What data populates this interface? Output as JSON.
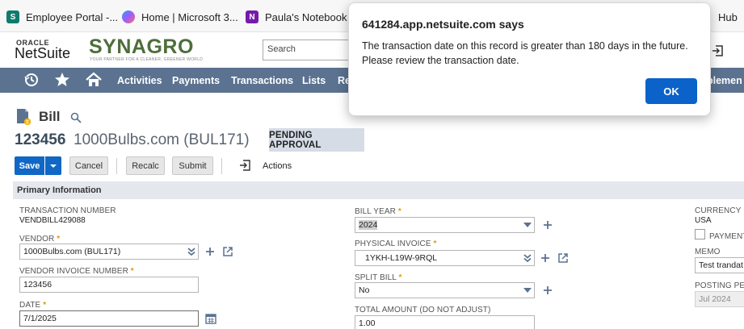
{
  "bookmarks": [
    {
      "label": "Employee Portal -...",
      "icon": "sharepoint-icon",
      "color": "#0f7b6c",
      "glyph": "S"
    },
    {
      "label": "Home | Microsoft 3...",
      "icon": "copilot-icon",
      "color": "#7b61ff",
      "glyph": "◆"
    },
    {
      "label": "Paula's Notebook -...",
      "icon": "onenote-icon",
      "color": "#7719aa",
      "glyph": "N"
    },
    {
      "label": "Hub",
      "icon": "hub-icon",
      "color": "#1e8e3e",
      "glyph": ""
    }
  ],
  "header": {
    "oracle": "ORACLE",
    "netsuite": "NetSuite",
    "company_logo": "SYNAGRO",
    "company_tagline": "YOUR PARTNER FOR A CLEANER, GREENER WORLD",
    "search_placeholder": "Search"
  },
  "nav": {
    "items": [
      "Activities",
      "Payments",
      "Transactions",
      "Lists",
      "Re",
      "plemen"
    ]
  },
  "record": {
    "type_label": "Bill",
    "number": "123456",
    "name": "1000Bulbs.com (BUL171)",
    "status": "PENDING APPROVAL"
  },
  "toolbar": {
    "save_label": "Save",
    "cancel_label": "Cancel",
    "recalc_label": "Recalc",
    "submit_label": "Submit",
    "actions_label": "Actions"
  },
  "section": {
    "title": "Primary Information"
  },
  "fields": {
    "transaction_number": {
      "label": "TRANSACTION NUMBER",
      "value": "VENDBILL429088"
    },
    "vendor": {
      "label": "VENDOR",
      "value": "1000Bulbs.com (BUL171)"
    },
    "vendor_invoice_number": {
      "label": "VENDOR INVOICE NUMBER",
      "value": "123456"
    },
    "date": {
      "label": "DATE",
      "value": "7/1/2025"
    },
    "bill_year": {
      "label": "BILL YEAR",
      "value": "2024"
    },
    "physical_invoice": {
      "label": "PHYSICAL INVOICE",
      "value": "1YKH-L19W-9RQL"
    },
    "split_bill": {
      "label": "SPLIT BILL",
      "value": "No"
    },
    "total_amount": {
      "label": "TOTAL AMOUNT (DO NOT ADJUST)",
      "value": "1.00"
    },
    "currency": {
      "label": "CURRENCY",
      "value": "USA"
    },
    "payment_hold": {
      "label": "PAYMENT"
    },
    "memo": {
      "label": "MEMO",
      "value": "Test trandat"
    },
    "posting_period": {
      "label": "POSTING PER",
      "value": "Jul 2024"
    }
  },
  "alert": {
    "title": "641284.app.netsuite.com says",
    "message": "The transaction date on this record is greater than 180 days in the future.  Please review the transaction date.",
    "ok_label": "OK"
  },
  "colors": {
    "nav_bg": "#5b7290",
    "primary_button": "#1067c6",
    "status_badge": "#d5dce6",
    "required_marker": "#e49a00"
  }
}
